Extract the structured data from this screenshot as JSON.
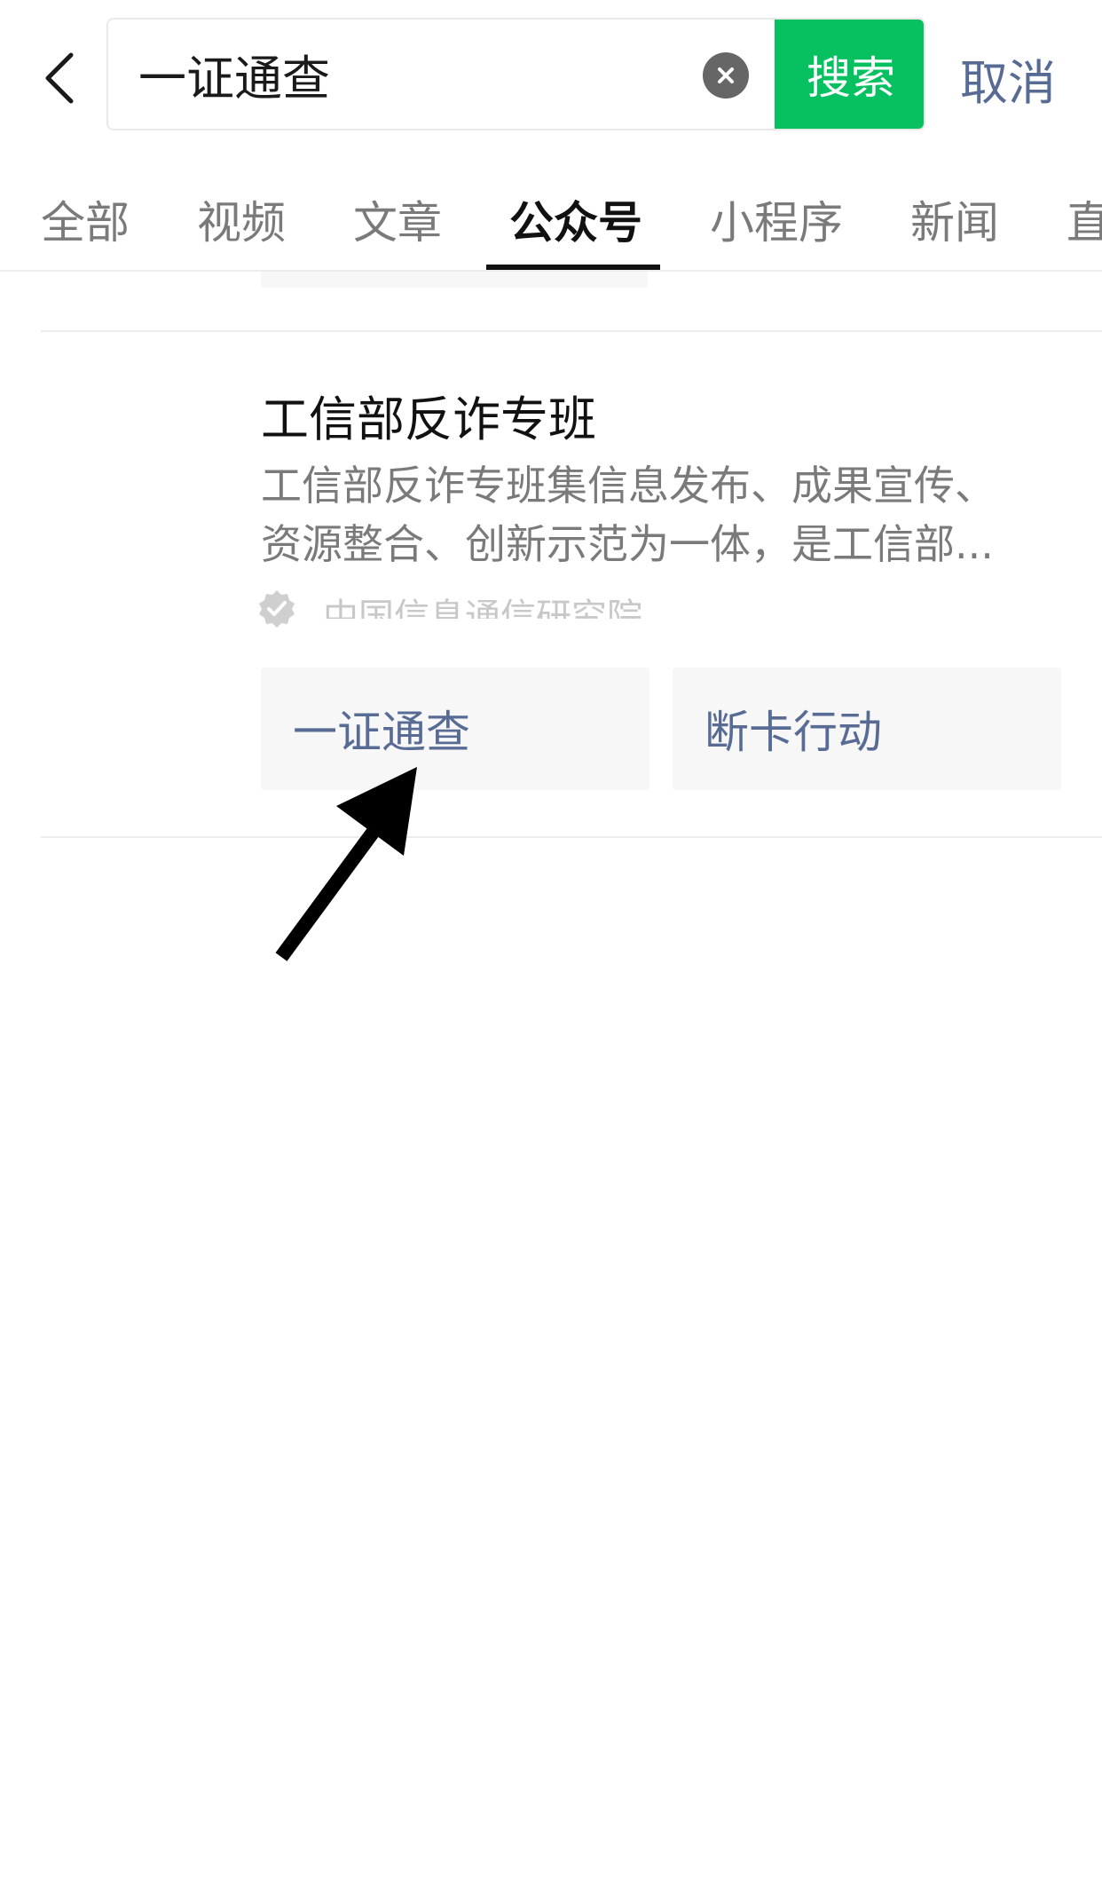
{
  "search": {
    "query": "一证通查",
    "search_label": "搜索",
    "cancel_label": "取消"
  },
  "tabs": [
    {
      "label": "全部"
    },
    {
      "label": "视频"
    },
    {
      "label": "文章"
    },
    {
      "label": "公众号",
      "active": true
    },
    {
      "label": "小程序"
    },
    {
      "label": "新闻"
    },
    {
      "label": "直"
    }
  ],
  "result": {
    "name": "工信部反诈专班",
    "description_line1": "工信部反诈专班集信息发布、成果宣传、",
    "description_line2": "资源整合、创新示范为一体，是工信部...",
    "verified_text": "中国信息通信研究院",
    "chips": [
      {
        "label": "一证通查"
      },
      {
        "label": "断卡行动"
      }
    ]
  },
  "colors": {
    "accent_green": "#07c160",
    "link_blue": "#576b95",
    "divider": "#ececec",
    "chip_bg": "#f7f7f7"
  },
  "icons": {
    "back": "chevron-left-icon",
    "clear": "clear-icon",
    "verified": "verified-badge-icon",
    "annotation": "annotation-arrow"
  }
}
